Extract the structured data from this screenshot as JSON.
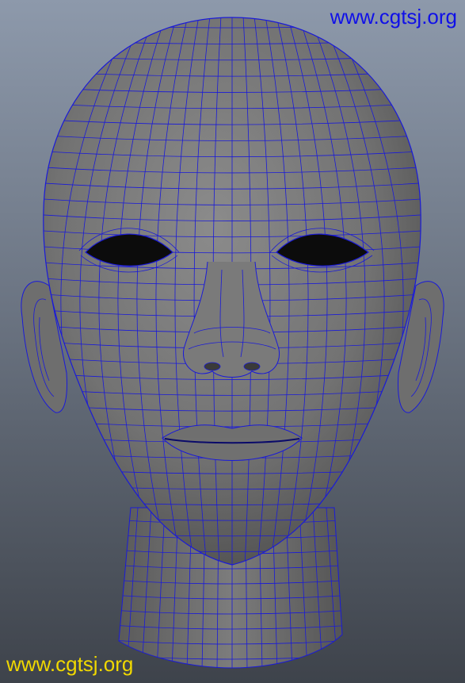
{
  "watermark": {
    "top_text": "www.cgtsj.org",
    "top_color": "#1010e8",
    "bottom_text": "www.cgtsj.org",
    "bottom_color": "#f0d800"
  },
  "model": {
    "subject": "head-wireframe",
    "surface_color": "#7a7a7a",
    "wire_color": "#1a1ad8"
  }
}
